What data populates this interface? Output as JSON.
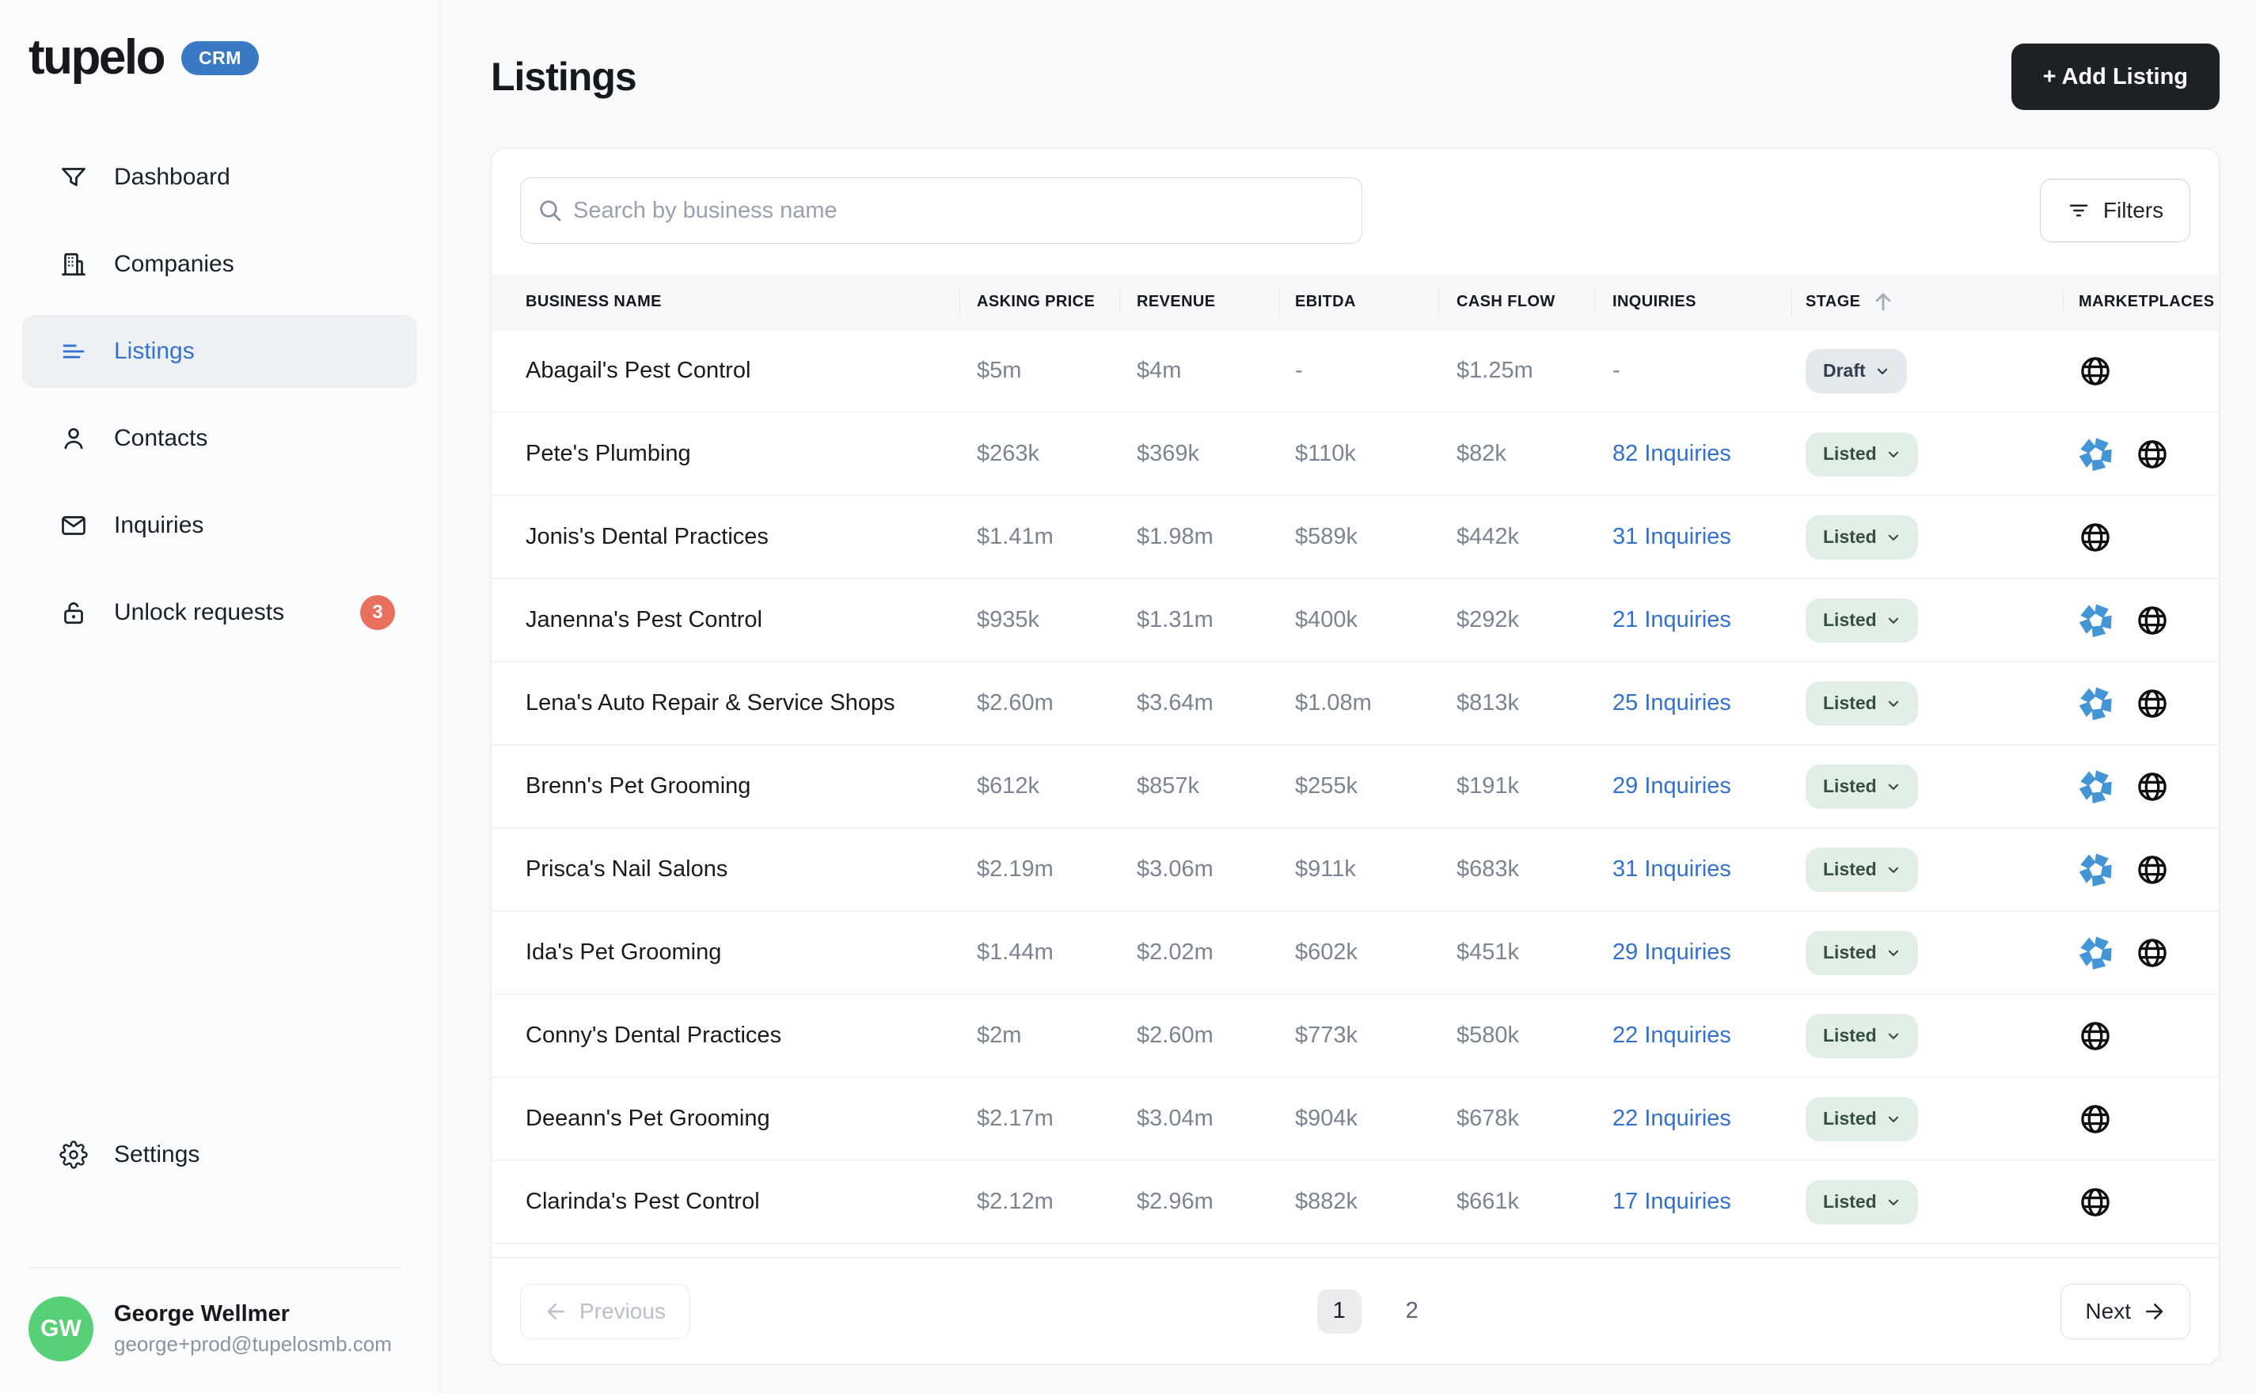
{
  "brand": {
    "name": "tupelo",
    "badge": "CRM"
  },
  "sidebar": {
    "nav": [
      {
        "label": "Dashboard",
        "icon": "funnel",
        "active": false,
        "badge": null
      },
      {
        "label": "Companies",
        "icon": "building",
        "active": false,
        "badge": null
      },
      {
        "label": "Listings",
        "icon": "list",
        "active": true,
        "badge": null
      },
      {
        "label": "Contacts",
        "icon": "person",
        "active": false,
        "badge": null
      },
      {
        "label": "Inquiries",
        "icon": "envelope",
        "active": false,
        "badge": null
      },
      {
        "label": "Unlock requests",
        "icon": "lock",
        "active": false,
        "badge": "3"
      }
    ],
    "settings": {
      "label": "Settings",
      "icon": "gear"
    },
    "user": {
      "initials": "GW",
      "name": "George Wellmer",
      "email": "george+prod@tupelosmb.com"
    }
  },
  "header": {
    "title": "Listings",
    "add_button": "+ Add Listing"
  },
  "toolbar": {
    "search_placeholder": "Search by business name",
    "filters_label": "Filters"
  },
  "table": {
    "columns": [
      "BUSINESS NAME",
      "ASKING PRICE",
      "REVENUE",
      "EBITDA",
      "CASH FLOW",
      "INQUIRIES",
      "STAGE",
      "MARKETPLACES"
    ],
    "sorted_column": "STAGE",
    "sort_direction": "asc",
    "rows": [
      {
        "business_name": "Abagail's Pest Control",
        "asking_price": "$5m",
        "revenue": "$4m",
        "ebitda": "-",
        "cash_flow": "$1.25m",
        "inquiries": "-",
        "stage": {
          "label": "Draft",
          "variant": "draft"
        },
        "marketplaces": [
          "globe"
        ]
      },
      {
        "business_name": "Pete's Plumbing",
        "asking_price": "$263k",
        "revenue": "$369k",
        "ebitda": "$110k",
        "cash_flow": "$82k",
        "inquiries": "82 Inquiries",
        "stage": {
          "label": "Listed",
          "variant": "listed"
        },
        "marketplaces": [
          "pinwheel",
          "globe"
        ]
      },
      {
        "business_name": "Jonis's Dental Practices",
        "asking_price": "$1.41m",
        "revenue": "$1.98m",
        "ebitda": "$589k",
        "cash_flow": "$442k",
        "inquiries": "31 Inquiries",
        "stage": {
          "label": "Listed",
          "variant": "listed"
        },
        "marketplaces": [
          "globe"
        ]
      },
      {
        "business_name": "Janenna's Pest Control",
        "asking_price": "$935k",
        "revenue": "$1.31m",
        "ebitda": "$400k",
        "cash_flow": "$292k",
        "inquiries": "21 Inquiries",
        "stage": {
          "label": "Listed",
          "variant": "listed"
        },
        "marketplaces": [
          "pinwheel",
          "globe"
        ]
      },
      {
        "business_name": "Lena's Auto Repair & Service Shops",
        "asking_price": "$2.60m",
        "revenue": "$3.64m",
        "ebitda": "$1.08m",
        "cash_flow": "$813k",
        "inquiries": "25 Inquiries",
        "stage": {
          "label": "Listed",
          "variant": "listed"
        },
        "marketplaces": [
          "pinwheel",
          "globe"
        ]
      },
      {
        "business_name": "Brenn's Pet Grooming",
        "asking_price": "$612k",
        "revenue": "$857k",
        "ebitda": "$255k",
        "cash_flow": "$191k",
        "inquiries": "29 Inquiries",
        "stage": {
          "label": "Listed",
          "variant": "listed"
        },
        "marketplaces": [
          "pinwheel",
          "globe"
        ]
      },
      {
        "business_name": "Prisca's Nail Salons",
        "asking_price": "$2.19m",
        "revenue": "$3.06m",
        "ebitda": "$911k",
        "cash_flow": "$683k",
        "inquiries": "31 Inquiries",
        "stage": {
          "label": "Listed",
          "variant": "listed"
        },
        "marketplaces": [
          "pinwheel",
          "globe"
        ]
      },
      {
        "business_name": "Ida's Pet Grooming",
        "asking_price": "$1.44m",
        "revenue": "$2.02m",
        "ebitda": "$602k",
        "cash_flow": "$451k",
        "inquiries": "29 Inquiries",
        "stage": {
          "label": "Listed",
          "variant": "listed"
        },
        "marketplaces": [
          "pinwheel",
          "globe"
        ]
      },
      {
        "business_name": "Conny's Dental Practices",
        "asking_price": "$2m",
        "revenue": "$2.60m",
        "ebitda": "$773k",
        "cash_flow": "$580k",
        "inquiries": "22 Inquiries",
        "stage": {
          "label": "Listed",
          "variant": "listed"
        },
        "marketplaces": [
          "globe"
        ]
      },
      {
        "business_name": "Deeann's Pet Grooming",
        "asking_price": "$2.17m",
        "revenue": "$3.04m",
        "ebitda": "$904k",
        "cash_flow": "$678k",
        "inquiries": "22 Inquiries",
        "stage": {
          "label": "Listed",
          "variant": "listed"
        },
        "marketplaces": [
          "globe"
        ]
      },
      {
        "business_name": "Clarinda's Pest Control",
        "asking_price": "$2.12m",
        "revenue": "$2.96m",
        "ebitda": "$882k",
        "cash_flow": "$661k",
        "inquiries": "17 Inquiries",
        "stage": {
          "label": "Listed",
          "variant": "listed"
        },
        "marketplaces": [
          "globe"
        ]
      }
    ]
  },
  "pagination": {
    "previous_label": "Previous",
    "pages": [
      "1",
      "2"
    ],
    "current_page": "1",
    "next_label": "Next"
  },
  "colors": {
    "accent_blue": "#3270d2",
    "crm_badge_blue": "#3a7ac5",
    "add_button_black": "#1d2125",
    "listed_pill_bg": "#e2efe6",
    "draft_pill_bg": "#e4e9ee",
    "unlock_badge_red": "#e8705c",
    "avatar_green": "#57d078",
    "marketplace_icon_blue": "#4495d6"
  }
}
